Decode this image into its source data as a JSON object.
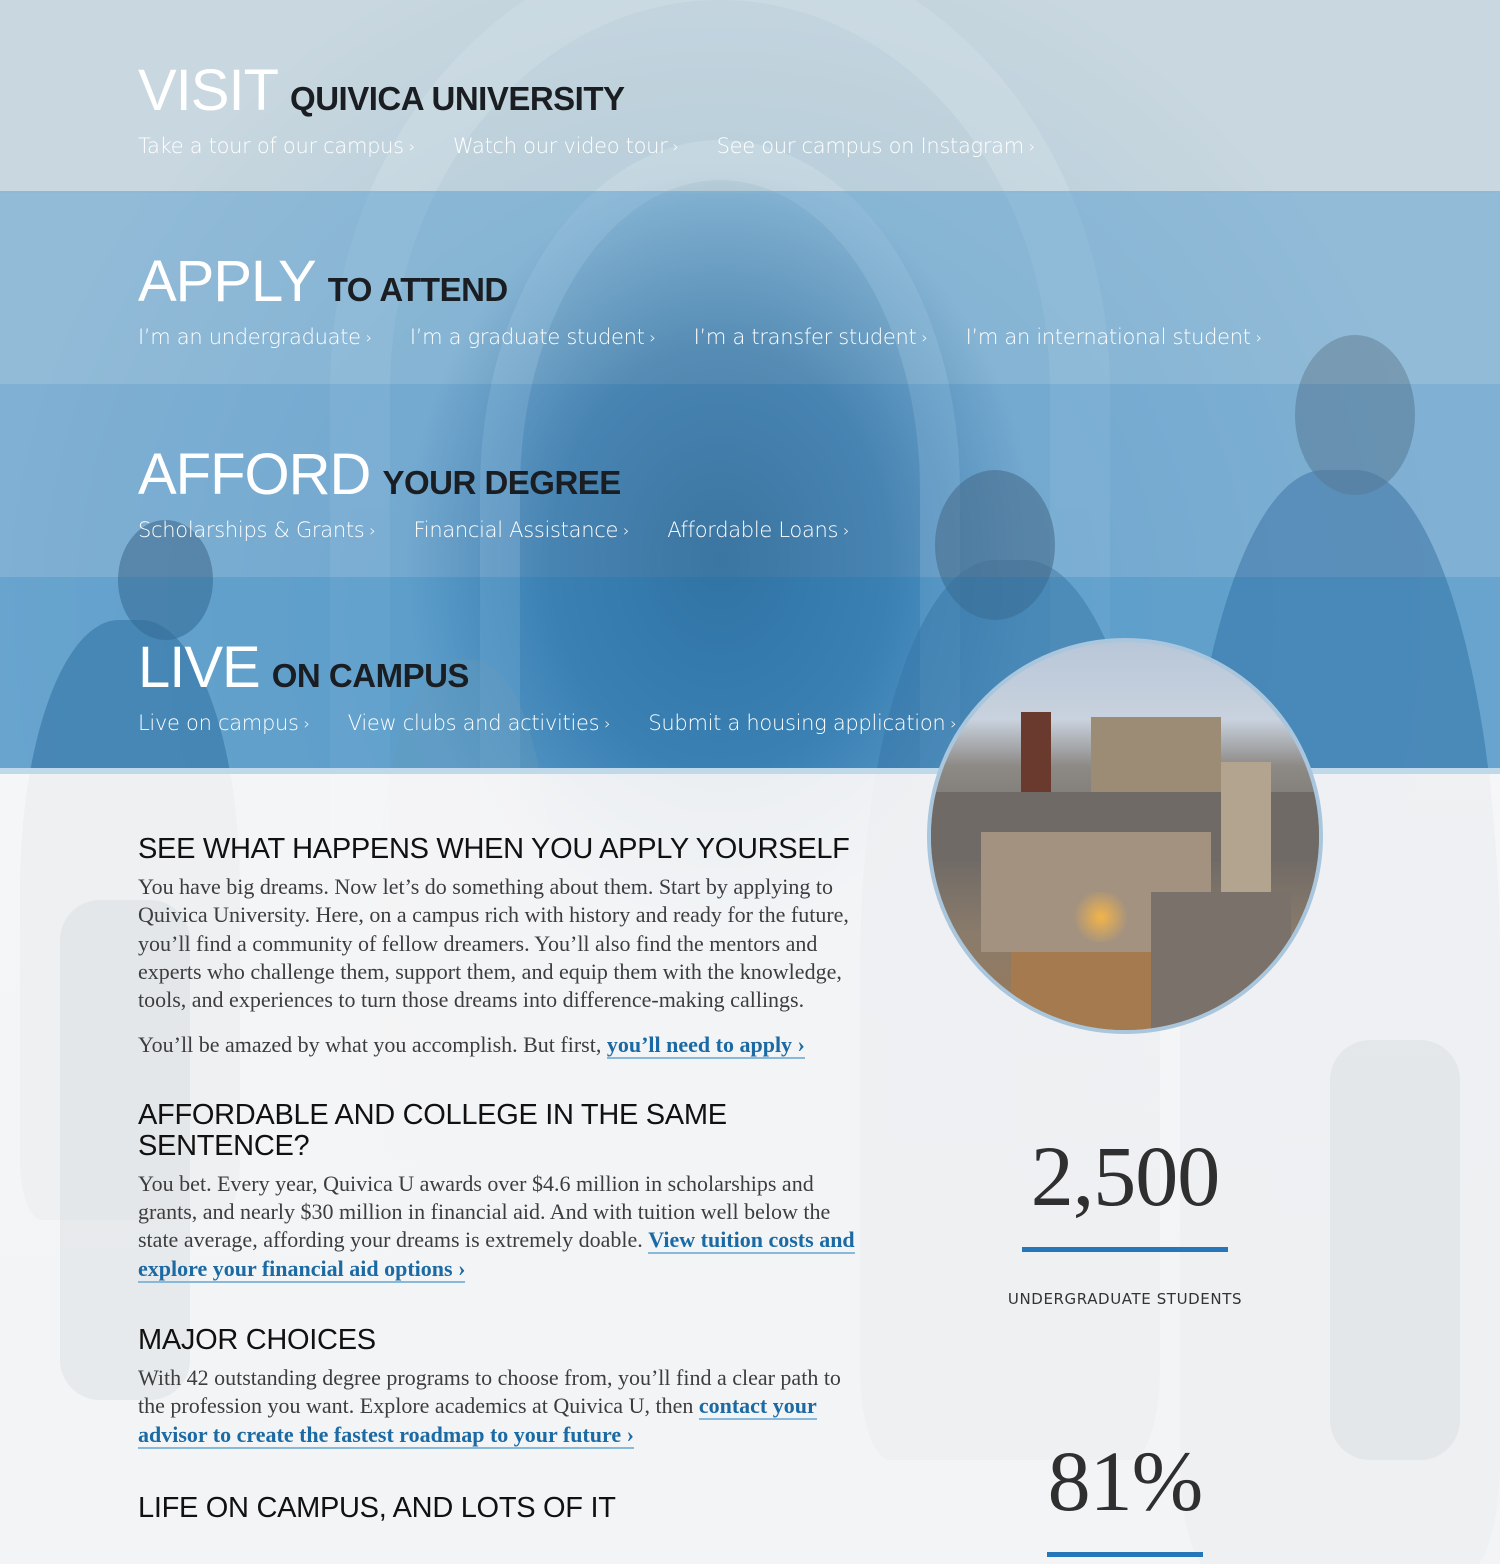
{
  "bands": [
    {
      "id": "visit",
      "title_big": "VISIT",
      "title_small": "QUIVICA UNIVERSITY",
      "links": [
        {
          "label": "Take a tour of our campus",
          "chevron": "›"
        },
        {
          "label": "Watch our video tour",
          "chevron": "›"
        },
        {
          "label": "See our campus on Instagram",
          "chevron": "›"
        }
      ]
    },
    {
      "id": "apply",
      "title_big": "APPLY",
      "title_small": "TO ATTEND",
      "links": [
        {
          "label": "I’m an undergraduate",
          "chevron": "›"
        },
        {
          "label": "I’m a graduate student",
          "chevron": "›"
        },
        {
          "label": "I’m a transfer student",
          "chevron": "›"
        },
        {
          "label": "I’m an international student",
          "chevron": "›"
        }
      ]
    },
    {
      "id": "afford",
      "title_big": "AFFORD",
      "title_small": "YOUR DEGREE",
      "links": [
        {
          "label": "Scholarships & Grants",
          "chevron": "›"
        },
        {
          "label": "Financial Assistance",
          "chevron": "›"
        },
        {
          "label": "Affordable Loans",
          "chevron": "›"
        }
      ]
    },
    {
      "id": "live",
      "title_big": "LIVE",
      "title_small": "ON CAMPUS",
      "links": [
        {
          "label": "Live on campus",
          "chevron": "›"
        },
        {
          "label": "View clubs and activities",
          "chevron": "›"
        },
        {
          "label": "Submit a housing application",
          "chevron": "›"
        }
      ]
    }
  ],
  "sections": [
    {
      "heading": "SEE WHAT HAPPENS WHEN YOU APPLY YOURSELF",
      "body": "You have big dreams. Now let’s do something about them. Start by applying to Quivica University. Here, on a campus rich with history and ready for the future, you’ll find a community of fellow dreamers. You’ll also find the mentors and experts who challenge them, support them, and equip them with the knowledge, tools, and experiences to turn those dreams into difference-making callings.",
      "body2_prefix": "You’ll be amazed by what you accomplish. But first, ",
      "link": "you’ll need to apply ›"
    },
    {
      "heading": "AFFORDABLE AND COLLEGE IN THE SAME SENTENCE?",
      "body_prefix": "You bet. Every year, Quivica U awards over $4.6 million in scholarships and grants, and nearly $30 million in financial aid. And with tuition well below the state average, affording your dreams is extremely doable. ",
      "link": "View tuition costs and explore your financial aid options ›"
    },
    {
      "heading": "MAJOR CHOICES",
      "body_prefix": "With 42 outstanding degree programs to choose from, you’ll find a clear path to the profession you want. Explore academics at Quivica U, then ",
      "link": "contact your advisor to create the fastest roadmap to your future ›"
    },
    {
      "heading": "LIFE ON CAMPUS, AND LOTS OF IT"
    }
  ],
  "stats": [
    {
      "value": "2,500",
      "label": "UNDERGRADUATE STUDENTS"
    },
    {
      "value": "81%",
      "label": ""
    }
  ],
  "images": {
    "campus_photo": "campus-aerial-photo",
    "background_photo": "students-walking-hallway-photo"
  },
  "colors": {
    "accent": "#2677ba",
    "link": "#1c6aa4",
    "band_live": "#3287c3"
  }
}
